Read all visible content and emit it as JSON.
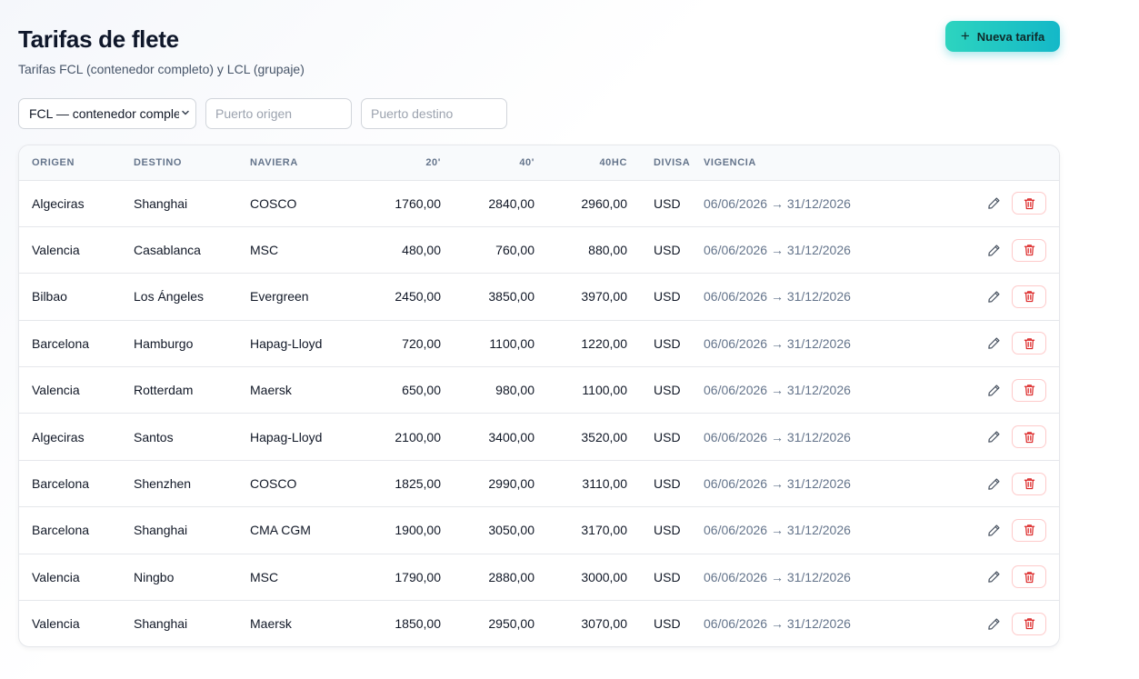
{
  "header": {
    "title": "Tarifas de flete",
    "subtitle": "Tarifas FCL (contenedor completo) y LCL (grupaje)",
    "new_button": "Nueva tarifa"
  },
  "filters": {
    "mode_selected": "FCL — contenedor completo",
    "origin_placeholder": "Puerto origen",
    "destination_placeholder": "Puerto destino"
  },
  "table": {
    "columns": [
      "ORIGEN",
      "DESTINO",
      "NAVIERA",
      "20'",
      "40'",
      "40HC",
      "DIVISA",
      "VIGENCIA"
    ],
    "rows": [
      {
        "origen": "Algeciras",
        "destino": "Shanghai",
        "naviera": "COSCO",
        "p20": "1760,00",
        "p40": "2840,00",
        "p40hc": "2960,00",
        "divisa": "USD",
        "vigencia": "06/06/2026 → 31/12/2026"
      },
      {
        "origen": "Valencia",
        "destino": "Casablanca",
        "naviera": "MSC",
        "p20": "480,00",
        "p40": "760,00",
        "p40hc": "880,00",
        "divisa": "USD",
        "vigencia": "06/06/2026 → 31/12/2026"
      },
      {
        "origen": "Bilbao",
        "destino": "Los Ángeles",
        "naviera": "Evergreen",
        "p20": "2450,00",
        "p40": "3850,00",
        "p40hc": "3970,00",
        "divisa": "USD",
        "vigencia": "06/06/2026 → 31/12/2026"
      },
      {
        "origen": "Barcelona",
        "destino": "Hamburgo",
        "naviera": "Hapag-Lloyd",
        "p20": "720,00",
        "p40": "1100,00",
        "p40hc": "1220,00",
        "divisa": "USD",
        "vigencia": "06/06/2026 → 31/12/2026"
      },
      {
        "origen": "Valencia",
        "destino": "Rotterdam",
        "naviera": "Maersk",
        "p20": "650,00",
        "p40": "980,00",
        "p40hc": "1100,00",
        "divisa": "USD",
        "vigencia": "06/06/2026 → 31/12/2026"
      },
      {
        "origen": "Algeciras",
        "destino": "Santos",
        "naviera": "Hapag-Lloyd",
        "p20": "2100,00",
        "p40": "3400,00",
        "p40hc": "3520,00",
        "divisa": "USD",
        "vigencia": "06/06/2026 → 31/12/2026"
      },
      {
        "origen": "Barcelona",
        "destino": "Shenzhen",
        "naviera": "COSCO",
        "p20": "1825,00",
        "p40": "2990,00",
        "p40hc": "3110,00",
        "divisa": "USD",
        "vigencia": "06/06/2026 → 31/12/2026"
      },
      {
        "origen": "Barcelona",
        "destino": "Shanghai",
        "naviera": "CMA CGM",
        "p20": "1900,00",
        "p40": "3050,00",
        "p40hc": "3170,00",
        "divisa": "USD",
        "vigencia": "06/06/2026 → 31/12/2026"
      },
      {
        "origen": "Valencia",
        "destino": "Ningbo",
        "naviera": "MSC",
        "p20": "1790,00",
        "p40": "2880,00",
        "p40hc": "3000,00",
        "divisa": "USD",
        "vigencia": "06/06/2026 → 31/12/2026"
      },
      {
        "origen": "Valencia",
        "destino": "Shanghai",
        "naviera": "Maersk",
        "p20": "1850,00",
        "p40": "2950,00",
        "p40hc": "3070,00",
        "divisa": "USD",
        "vigencia": "06/06/2026 → 31/12/2026"
      }
    ]
  },
  "icons": {
    "add": "plus-icon",
    "edit": "pencil-icon",
    "delete": "trash-icon",
    "select_arrow": "chevron-down-icon"
  },
  "colors": {
    "accent": "#14b8c8",
    "delete": "#dc2626"
  }
}
